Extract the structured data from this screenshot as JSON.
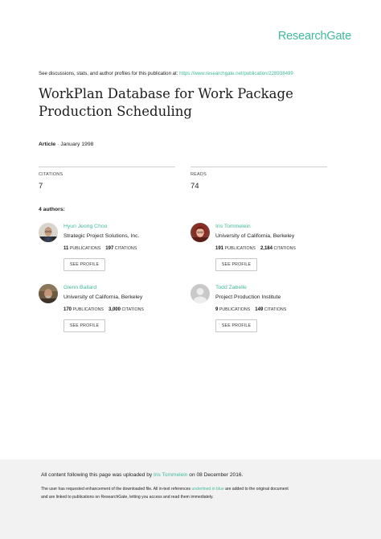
{
  "brand": {
    "name": "ResearchGate",
    "color": "#40ba9b"
  },
  "discussion": {
    "text": "See discussions, stats, and author profiles for this publication at:",
    "url": "https://www.researchgate.net/publication/228938499"
  },
  "publication": {
    "title": "WorkPlan Database for Work Package Production Scheduling",
    "type": "Article",
    "date": "January 1998"
  },
  "stats": {
    "citations": {
      "label": "CITATIONS",
      "value": "7"
    },
    "reads": {
      "label": "READS",
      "value": "74"
    }
  },
  "authors_heading": "4 authors:",
  "authors": [
    {
      "name": "Hyun Jeong Choo",
      "institution": "Strategic Project Solutions, Inc.",
      "publications": "11",
      "citations": "197",
      "button": "SEE PROFILE",
      "avatar_icon": "photo-avatar-icon"
    },
    {
      "name": "Iris Tommelein",
      "institution": "University of California, Berkeley",
      "publications": "191",
      "citations": "2,184",
      "button": "SEE PROFILE",
      "avatar_icon": "photo-avatar-icon"
    },
    {
      "name": "Glenn Ballard",
      "institution": "University of California, Berkeley",
      "publications": "170",
      "citations": "3,000",
      "button": "SEE PROFILE",
      "avatar_icon": "photo-avatar-icon"
    },
    {
      "name": "Todd Zabelle",
      "institution": "Project Production Institute",
      "publications": "9",
      "citations": "149",
      "button": "SEE PROFILE",
      "avatar_icon": "default-avatar-icon"
    }
  ],
  "labels": {
    "publications": "PUBLICATIONS",
    "citations": "CITATIONS",
    "separator": " · "
  },
  "footer": {
    "uploaded_prefix": "All content following this page was uploaded by",
    "uploader": "Iris Tommelein",
    "uploaded_suffix": "on 08 December 2016.",
    "note_line1_prefix": "The user has requested enhancement of the downloaded file. All in-text references",
    "note_link": "underlined in blue",
    "note_line1_suffix": "are added to the original document",
    "note_line2": "and are linked to publications on ResearchGate, letting you access and read them immediately."
  }
}
